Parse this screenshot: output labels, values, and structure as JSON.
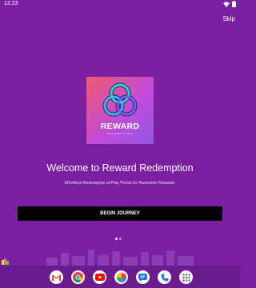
{
  "status_bar": {
    "time": "12:23"
  },
  "skip_label": "Skip",
  "logo": {
    "name": "REWARD",
    "subtitle": "REDEMPTION"
  },
  "welcome": {
    "title": "Welcome to Reward Redemption",
    "subtitle": "Effortless Redemption of Play Points for Awesome Rewards."
  },
  "cta_label": "BEGIN JOURNEY",
  "pager": {
    "total": 2,
    "active": 1
  },
  "dock_apps": [
    "gmail-icon",
    "chrome-icon",
    "youtube-icon",
    "photos-icon",
    "messages-icon",
    "phone-icon",
    "app-drawer-icon"
  ],
  "colors": {
    "background": "#7b1fa2",
    "button": "#000000",
    "logo_gradient_start": "#ef5a6f",
    "logo_gradient_end": "#8e58e8"
  }
}
